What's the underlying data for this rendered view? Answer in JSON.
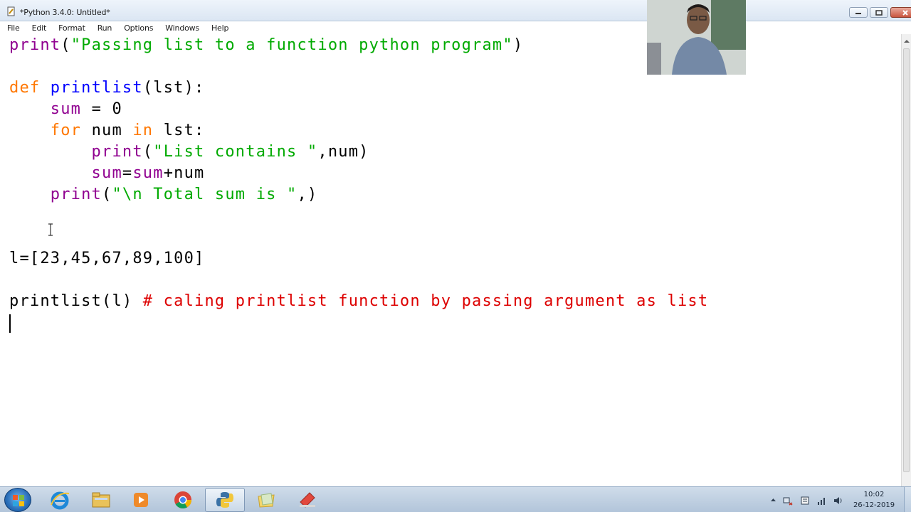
{
  "window": {
    "title": "*Python 3.4.0: Untitled*"
  },
  "menu": [
    "File",
    "Edit",
    "Format",
    "Run",
    "Options",
    "Windows",
    "Help"
  ],
  "code": {
    "lines": [
      [
        {
          "t": "print",
          "c": "bi"
        },
        {
          "t": "(",
          "c": ""
        },
        {
          "t": "\"Passing list to a function python program\"",
          "c": "st"
        },
        {
          "t": ")",
          "c": ""
        }
      ],
      [],
      [
        {
          "t": "def",
          "c": "kw"
        },
        {
          "t": " ",
          "c": ""
        },
        {
          "t": "printlist",
          "c": "fn"
        },
        {
          "t": "(lst):",
          "c": ""
        }
      ],
      [
        {
          "t": "    sum",
          "c": "bi"
        },
        {
          "t": " = 0",
          "c": ""
        }
      ],
      [
        {
          "t": "    for",
          "c": "kw"
        },
        {
          "t": " num ",
          "c": ""
        },
        {
          "t": "in",
          "c": "kw"
        },
        {
          "t": " lst:",
          "c": ""
        }
      ],
      [
        {
          "t": "        print",
          "c": "bi"
        },
        {
          "t": "(",
          "c": ""
        },
        {
          "t": "\"List contains \"",
          "c": "st"
        },
        {
          "t": ",num)",
          "c": ""
        }
      ],
      [
        {
          "t": "        sum",
          "c": "bi"
        },
        {
          "t": "=",
          "c": ""
        },
        {
          "t": "sum",
          "c": "bi"
        },
        {
          "t": "+num",
          "c": ""
        }
      ],
      [
        {
          "t": "    print",
          "c": "bi"
        },
        {
          "t": "(",
          "c": ""
        },
        {
          "t": "\"\\n Total sum is \"",
          "c": "st"
        },
        {
          "t": ",)",
          "c": ""
        }
      ],
      [],
      [],
      [
        {
          "t": "l=[23,45,67,89,100]",
          "c": ""
        }
      ],
      [],
      [
        {
          "t": "printlist(l) ",
          "c": ""
        },
        {
          "t": "# caling printlist function by passing argument as list",
          "c": "cm"
        }
      ],
      []
    ]
  },
  "taskbar": {
    "apps": [
      "start-orb",
      "internet-explorer",
      "file-explorer",
      "media-player",
      "chrome",
      "python-idle",
      "folder",
      "paint"
    ],
    "active_app": "python-idle"
  },
  "clock": {
    "time": "10:02",
    "date": "26-12-2019"
  },
  "colors": {
    "keyword": "#ff7700",
    "builtin": "#900090",
    "definition": "#0000ff",
    "string": "#00aa00",
    "comment": "#dd0000"
  }
}
